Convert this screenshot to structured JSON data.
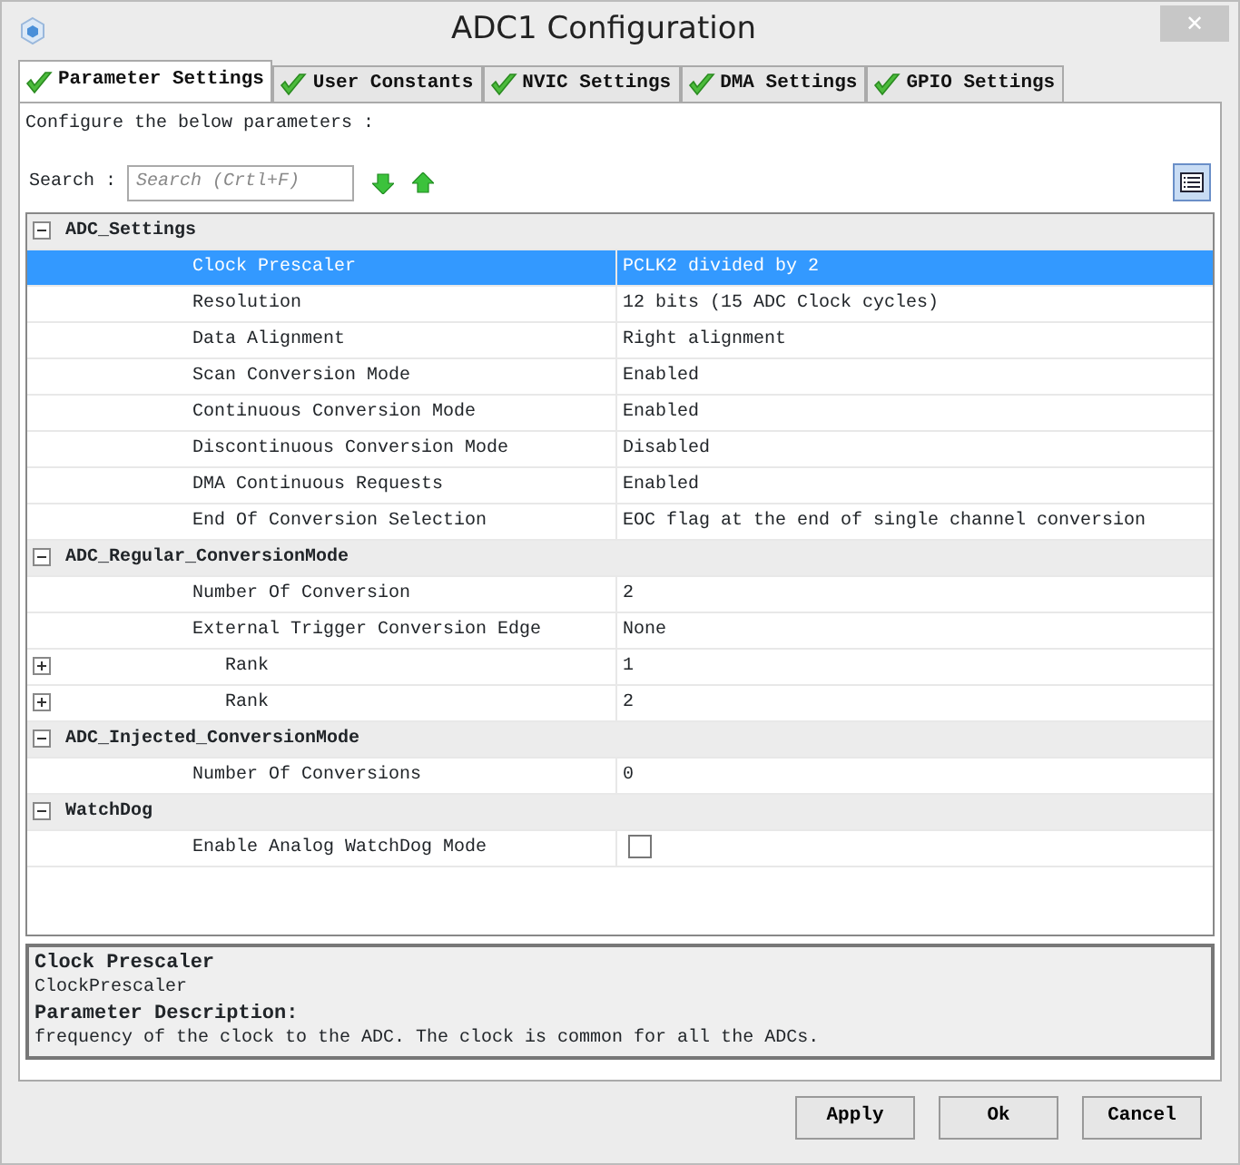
{
  "window": {
    "title": "ADC1 Configuration",
    "close": "✕"
  },
  "tabs": [
    {
      "label": "Parameter Settings",
      "selected": true
    },
    {
      "label": "User Constants",
      "selected": false
    },
    {
      "label": "NVIC Settings",
      "selected": false
    },
    {
      "label": "DMA Settings",
      "selected": false
    },
    {
      "label": "GPIO Settings",
      "selected": false
    }
  ],
  "intro": "Configure the below parameters :",
  "search": {
    "label": "Search :",
    "placeholder": "Search (Crtl+F)"
  },
  "tree": [
    {
      "name": "ADC_Settings",
      "expanded": true,
      "rows": [
        {
          "kind": "value",
          "name": "Clock Prescaler",
          "value": "PCLK2 divided by 2",
          "selected": true
        },
        {
          "kind": "value",
          "name": "Resolution",
          "value": "12 bits (15 ADC Clock cycles)",
          "selected": false
        },
        {
          "kind": "value",
          "name": "Data Alignment",
          "value": "Right alignment",
          "selected": false
        },
        {
          "kind": "value",
          "name": "Scan Conversion Mode",
          "value": "Enabled",
          "selected": false
        },
        {
          "kind": "value",
          "name": "Continuous Conversion Mode",
          "value": "Enabled",
          "selected": false
        },
        {
          "kind": "value",
          "name": "Discontinuous Conversion Mode",
          "value": "Disabled",
          "selected": false
        },
        {
          "kind": "value",
          "name": "DMA Continuous Requests",
          "value": "Enabled",
          "selected": false
        },
        {
          "kind": "value",
          "name": "End Of Conversion Selection",
          "value": "EOC flag at the end of single channel conversion",
          "selected": false
        }
      ]
    },
    {
      "name": "ADC_Regular_ConversionMode",
      "expanded": true,
      "rows": [
        {
          "kind": "value",
          "name": "Number Of Conversion",
          "value": "2",
          "selected": false
        },
        {
          "kind": "value",
          "name": "External Trigger Conversion Edge",
          "value": "None",
          "selected": false
        },
        {
          "kind": "sublist",
          "name": "Rank",
          "value": "1",
          "selected": false,
          "expanded": false
        },
        {
          "kind": "sublist",
          "name": "Rank",
          "value": "2",
          "selected": false,
          "expanded": false
        }
      ]
    },
    {
      "name": "ADC_Injected_ConversionMode",
      "expanded": true,
      "rows": [
        {
          "kind": "value",
          "name": "Number Of Conversions",
          "value": "0",
          "selected": false
        }
      ]
    },
    {
      "name": "WatchDog",
      "expanded": true,
      "rows": [
        {
          "kind": "checkbox",
          "name": "Enable Analog WatchDog Mode",
          "checked": false,
          "selected": false
        }
      ]
    }
  ],
  "description": {
    "title": "Clock Prescaler",
    "parameter": "ClockPrescaler",
    "heading": "Parameter Description:",
    "text": "frequency of the clock to the ADC. The clock is common for all the ADCs."
  },
  "buttons": [
    "Apply",
    "Ok",
    "Cancel"
  ]
}
